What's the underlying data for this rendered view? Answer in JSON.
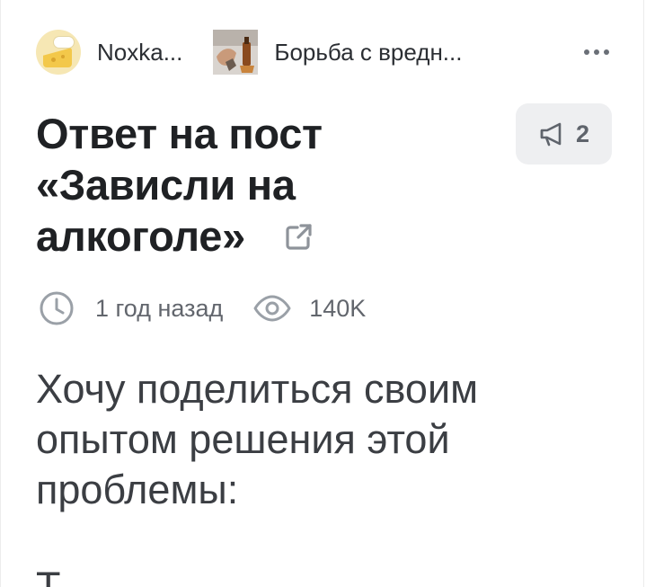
{
  "header": {
    "author_name": "Noxka...",
    "community_name": "Борьба с вредн...",
    "author_avatar_icon": "cheese-avatar-icon",
    "community_thumb_icon": "alcohol-hands-thumbnail-icon",
    "more_icon": "more-horizontal-icon"
  },
  "post": {
    "title_line1": "Ответ на пост",
    "title_line2": "«Зависли на",
    "title_line3": "алкоголе»",
    "external_link_icon": "external-link-icon",
    "shares_count": "2",
    "share_icon": "megaphone-icon",
    "time_ago": "1 год назад",
    "time_icon": "clock-icon",
    "views": "140K",
    "views_icon": "eye-icon",
    "body_line1": "Хочу поделиться своим",
    "body_line2": "опытом решения этой",
    "body_line3": "проблемы:",
    "body_next": "Т"
  },
  "colors": {
    "title": "#1f2124",
    "meta": "#62666d",
    "body": "#3b3e43",
    "badge_bg": "#eeeff1",
    "icon_gray": "#8e939a"
  }
}
